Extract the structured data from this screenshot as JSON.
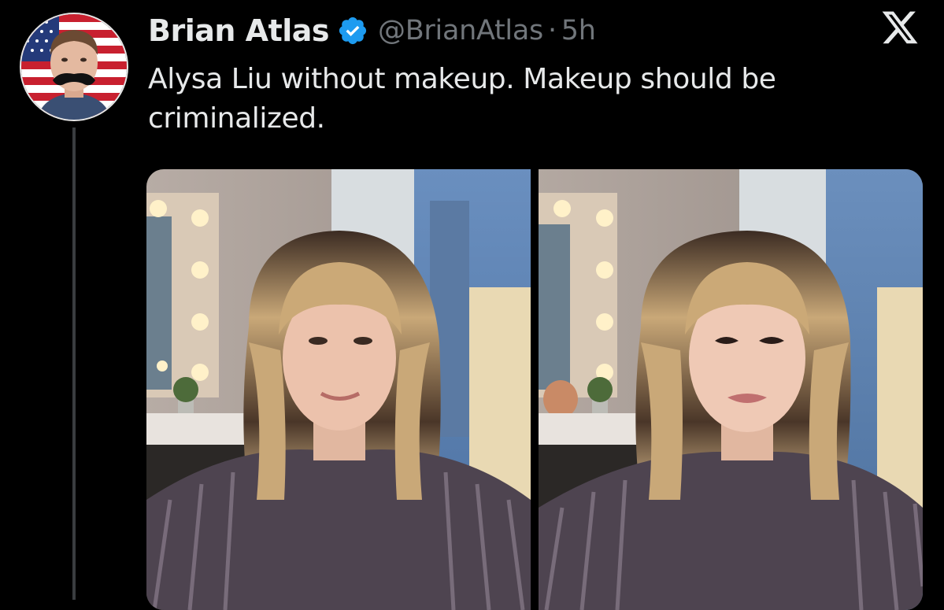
{
  "tweet": {
    "author": {
      "display_name": "Brian Atlas",
      "handle": "@BrianAtlas",
      "verified": true,
      "avatar_icon": "american-flag-mustache-avatar"
    },
    "separator": "·",
    "timestamp": "5h",
    "text": "Alysa Liu without makeup. Makeup should be criminalized.",
    "platform_icon": "x-logo-icon",
    "media": [
      {
        "kind": "photo",
        "icon": "photo-without-makeup"
      },
      {
        "kind": "photo",
        "icon": "photo-with-makeup"
      }
    ]
  },
  "colors": {
    "background": "#000000",
    "text_primary": "#e7e9ea",
    "text_secondary": "#71767b",
    "verified_blue": "#1d9bf0",
    "thread_line": "#3a3d40"
  }
}
